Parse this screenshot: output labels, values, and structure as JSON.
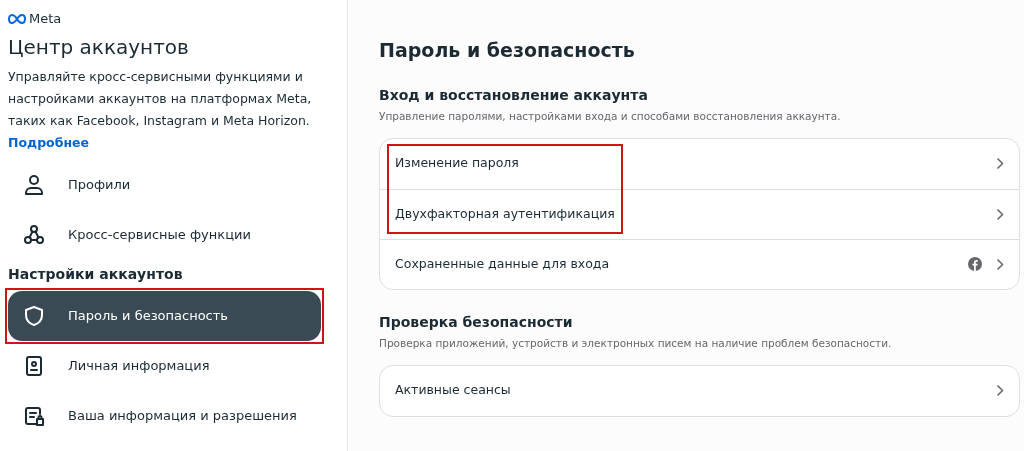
{
  "sidebar": {
    "brand": "Meta",
    "title": "Центр аккаунтов",
    "description": "Управляйте кросс-сервисными функциями и настройками аккаунтов на платформах Meta, таких как Facebook, Instagram и Meta Horizon.",
    "more_link": "Подробнее",
    "items": [
      {
        "kind": "person",
        "label": "Профили",
        "selected": false,
        "highlighted": false
      },
      {
        "kind": "nodes",
        "label": "Кросс-сервисные функции",
        "selected": false,
        "highlighted": false
      }
    ],
    "section_title": "Настройки аккаунтов",
    "settings_items": [
      {
        "kind": "shield",
        "label": "Пароль и безопасность",
        "selected": true,
        "highlighted": true
      },
      {
        "kind": "id",
        "label": "Личная информация",
        "selected": false,
        "highlighted": false
      },
      {
        "kind": "doc",
        "label": "Ваша информация и разрешения",
        "selected": false,
        "highlighted": false
      }
    ]
  },
  "main": {
    "title": "Пароль и безопасность",
    "sections": [
      {
        "title": "Вход и восстановление аккаунта",
        "subtitle": "Управление паролями, настройками входа и способами восстановления аккаунта.",
        "rows": [
          {
            "kind": "annotated_group",
            "rows": [
              {
                "label": "Изменение пароля",
                "facebook": false
              },
              {
                "label": "Двухфакторная аутентификация",
                "facebook": false
              }
            ]
          },
          {
            "kind": "row",
            "label": "Сохраненные данные для входа",
            "facebook": true
          }
        ]
      },
      {
        "title": "Проверка безопасности",
        "subtitle": "Проверка приложений, устройств и электронных писем на наличие проблем безопасности.",
        "rows": [
          {
            "kind": "row",
            "label": "Активные сеансы",
            "facebook": false
          }
        ]
      }
    ]
  }
}
